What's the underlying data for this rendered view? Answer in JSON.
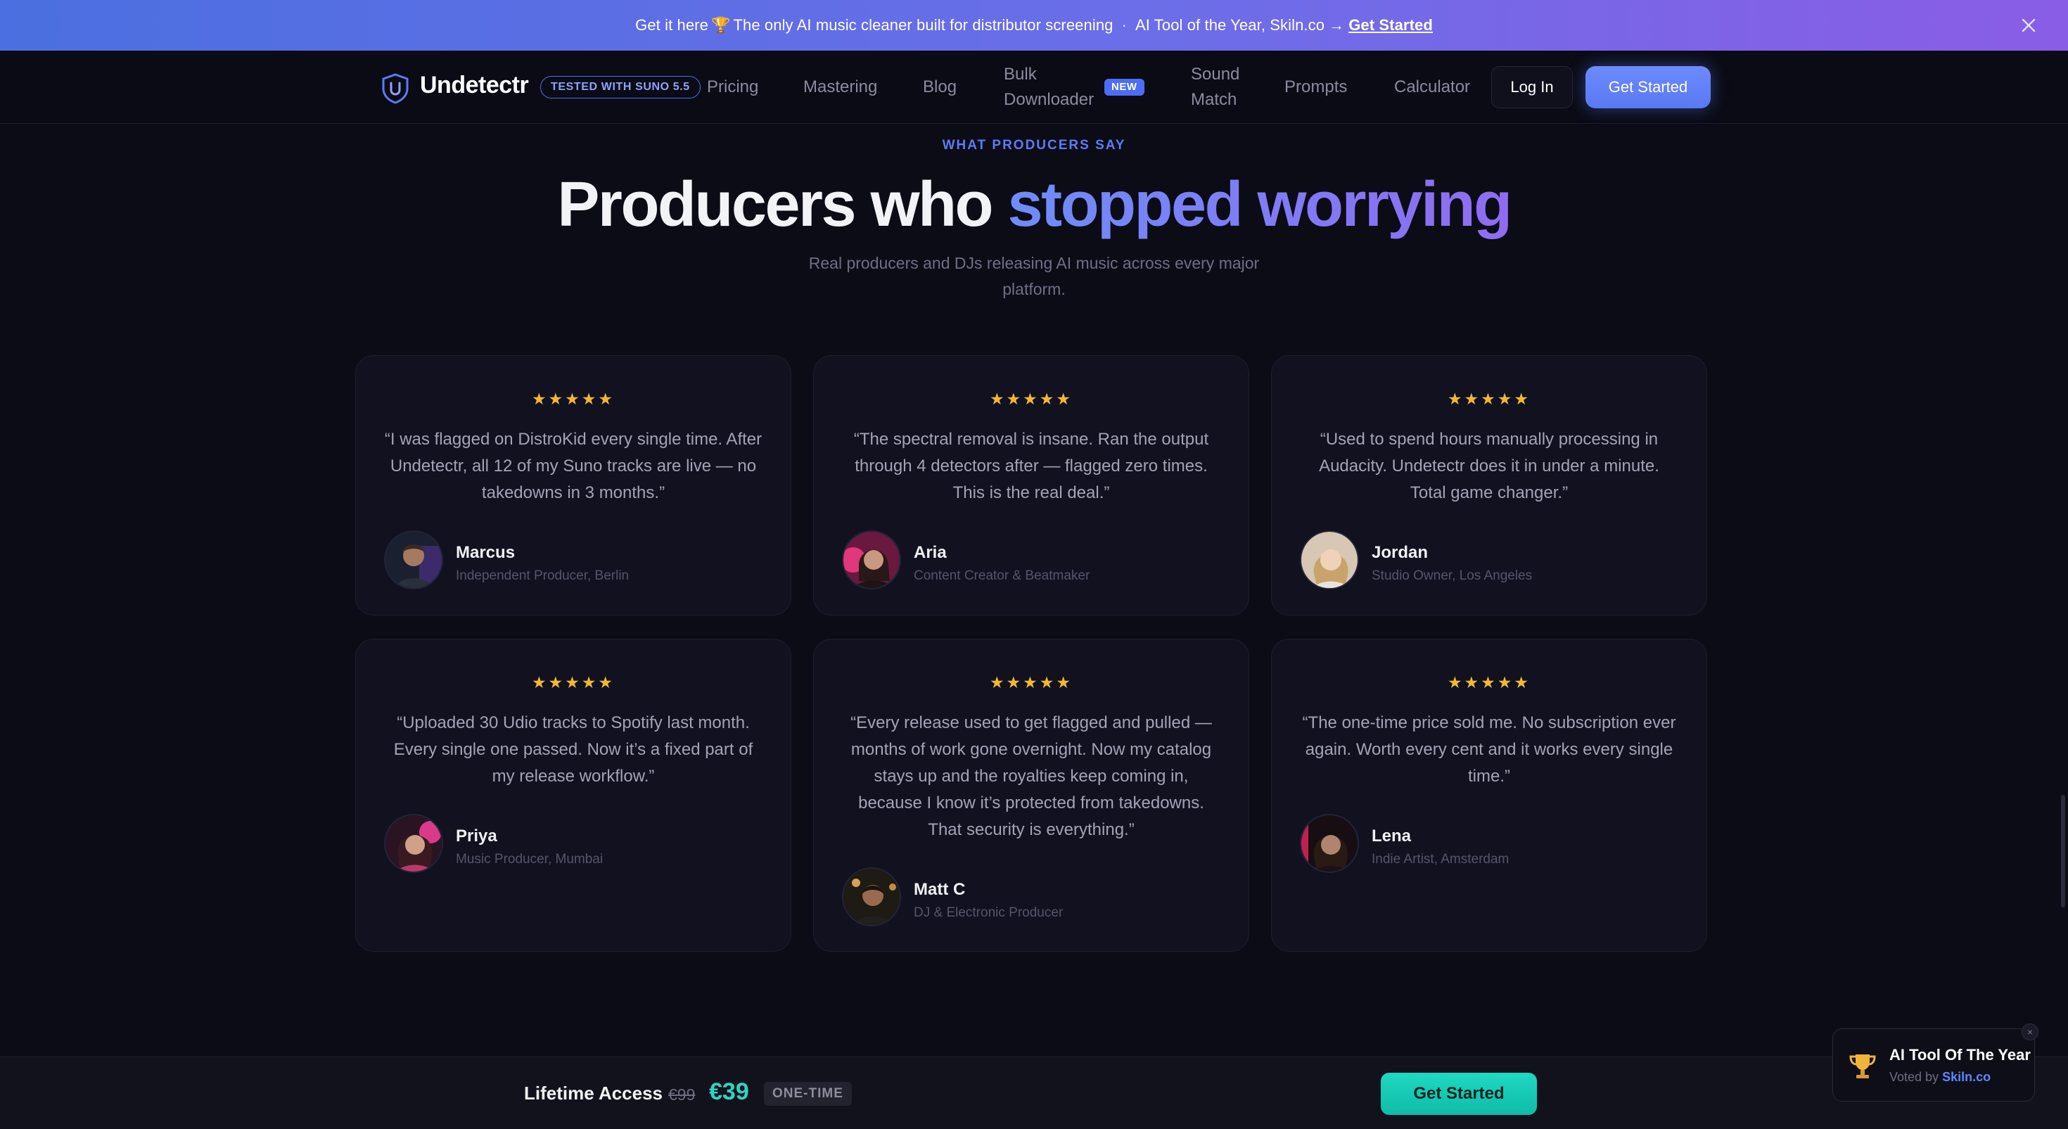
{
  "promo": {
    "lead": "Get it here",
    "trophy": "🏆",
    "text": "The only AI music cleaner built for distributor screening",
    "separator": "·",
    "award_text": "AI Tool of the Year, Skiln.co",
    "arrow": "→",
    "cta": "Get Started"
  },
  "nav": {
    "brand": "Undetectr",
    "badge": "TESTED WITH SUNO 5.5",
    "links": {
      "pricing": "Pricing",
      "mastering": "Mastering",
      "blog": "Blog",
      "bulk_1": "Bulk",
      "bulk_2": "Downloader",
      "sound_1": "Sound",
      "sound_2": "Match",
      "prompts": "Prompts",
      "calculator": "Calculator"
    },
    "new_badge": "NEW",
    "login": "Log In",
    "get_started": "Get Started"
  },
  "section": {
    "eyebrow": "WHAT PRODUCERS SAY",
    "headline_plain": "Producers who ",
    "headline_accent": "stopped worrying",
    "subhead": "Real producers and DJs releasing AI music across every major platform."
  },
  "testimonials": [
    {
      "stars": "★★★★★",
      "rating": 5,
      "quote": "“I was flagged on DistroKid every single time. After Undetectr, all 12 of my Suno tracks are live — no takedowns in 3 months.”",
      "name": "Marcus",
      "role": "Independent Producer, Berlin"
    },
    {
      "stars": "★★★★★",
      "rating": 5,
      "quote": "“The spectral removal is insane. Ran the output through 4 detectors after — flagged zero times. This is the real deal.”",
      "name": "Aria",
      "role": "Content Creator & Beatmaker"
    },
    {
      "stars": "★★★★★",
      "rating": 5,
      "quote": "“Used to spend hours manually processing in Audacity. Undetectr does it in under a minute. Total game changer.”",
      "name": "Jordan",
      "role": "Studio Owner, Los Angeles"
    },
    {
      "stars": "★★★★★",
      "rating": 5,
      "quote": "“Uploaded 30 Udio tracks to Spotify last month. Every single one passed. Now it’s a fixed part of my release workflow.”",
      "name": "Priya",
      "role": "Music Producer, Mumbai"
    },
    {
      "stars": "★★★★★",
      "rating": 5,
      "quote": "“Every release used to get flagged and pulled — months of work gone overnight. Now my catalog stays up and the royalties keep coming in, because I know it’s protected from takedowns. That security is everything.”",
      "name": "Matt C",
      "role": "DJ & Electronic Producer"
    },
    {
      "stars": "★★★★★",
      "rating": 5,
      "quote": "“The one-time price sold me. No subscription ever again. Worth every cent and it works every single time.”",
      "name": "Lena",
      "role": "Indie Artist, Amsterdam"
    }
  ],
  "bottom_bar": {
    "label": "Lifetime Access",
    "old_price": "€99",
    "price": "€39",
    "badge": "ONE-TIME",
    "cta": "Get Started"
  },
  "award": {
    "title": "AI Tool Of The Year",
    "voted_by": "Voted by",
    "source": "Skiln.co",
    "close": "×"
  },
  "colors": {
    "accent": "#5a78f2",
    "gradient_start": "#6f8cf8",
    "gradient_end": "#8f6cf1",
    "star": "#f3b92e",
    "teal": "#2fd4c0",
    "background": "#0c0c17"
  },
  "icons": {
    "close": "close-icon",
    "logo": "shield-logo-icon",
    "trophy": "trophy-icon"
  }
}
